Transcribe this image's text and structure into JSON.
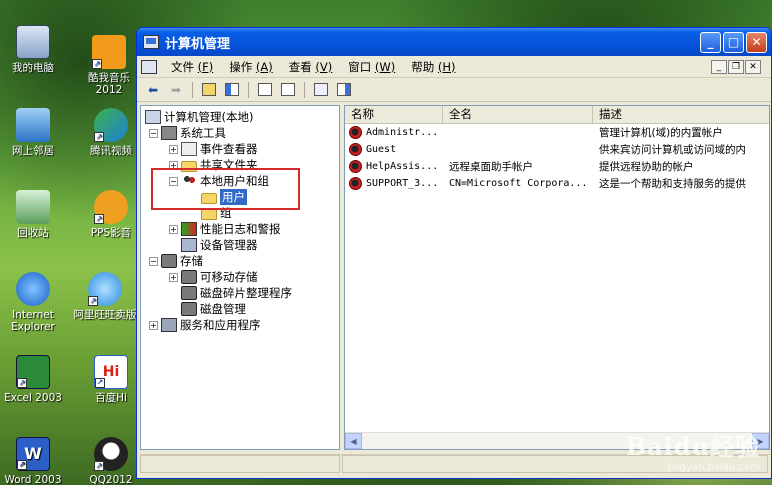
{
  "desktop": {
    "icons": [
      {
        "name": "my-computer",
        "label": "我的电脑"
      },
      {
        "name": "kuwo-music",
        "label": "酷我音乐2012"
      },
      {
        "name": "network-places",
        "label": "网上邻居"
      },
      {
        "name": "tencent-video",
        "label": "腾讯视频"
      },
      {
        "name": "recycle-bin",
        "label": "回收站"
      },
      {
        "name": "pps-player",
        "label": "PPS影音"
      },
      {
        "name": "internet-explorer",
        "label": "Internet Explorer"
      },
      {
        "name": "aliwangwang",
        "label": "阿里旺旺卖版"
      },
      {
        "name": "excel-2003",
        "label": "Excel 2003"
      },
      {
        "name": "baidu-hi",
        "label": "百度Hi"
      },
      {
        "name": "word-2003",
        "label": "Word 2003"
      },
      {
        "name": "qq2012",
        "label": "QQ2012"
      }
    ]
  },
  "window": {
    "title": "计算机管理",
    "menu": [
      {
        "label": "文件",
        "key": "(F)"
      },
      {
        "label": "操作",
        "key": "(A)"
      },
      {
        "label": "查看",
        "key": "(V)"
      },
      {
        "label": "窗口",
        "key": "(W)"
      },
      {
        "label": "帮助",
        "key": "(H)"
      }
    ],
    "tree": {
      "root": "计算机管理(本地)",
      "system_tools": "系统工具",
      "event_viewer": "事件查看器",
      "shared_folders": "共享文件夹",
      "local_users_groups": "本地用户和组",
      "users": "用户",
      "groups": "组",
      "perf_logs": "性能日志和警报",
      "device_manager": "设备管理器",
      "storage": "存储",
      "removable_storage": "可移动存储",
      "defrag": "磁盘碎片整理程序",
      "disk_mgmt": "磁盘管理",
      "services_apps": "服务和应用程序"
    },
    "list": {
      "columns": [
        "名称",
        "全名",
        "描述"
      ],
      "rows": [
        {
          "name": "Administr...",
          "fullname": "",
          "desc": "管理计算机(域)的内置帐户"
        },
        {
          "name": "Guest",
          "fullname": "",
          "desc": "供来宾访问计算机或访问域的内"
        },
        {
          "name": "HelpAssis...",
          "fullname": "远程桌面助手帐户",
          "desc": "提供远程协助的帐户"
        },
        {
          "name": "SUPPORT_3...",
          "fullname": "CN=Microsoft Corpora...",
          "desc": "这是一个帮助和支持服务的提供"
        }
      ]
    }
  },
  "watermark": {
    "logo": "Baidu经验",
    "url": "jingyan.baidu.com"
  }
}
